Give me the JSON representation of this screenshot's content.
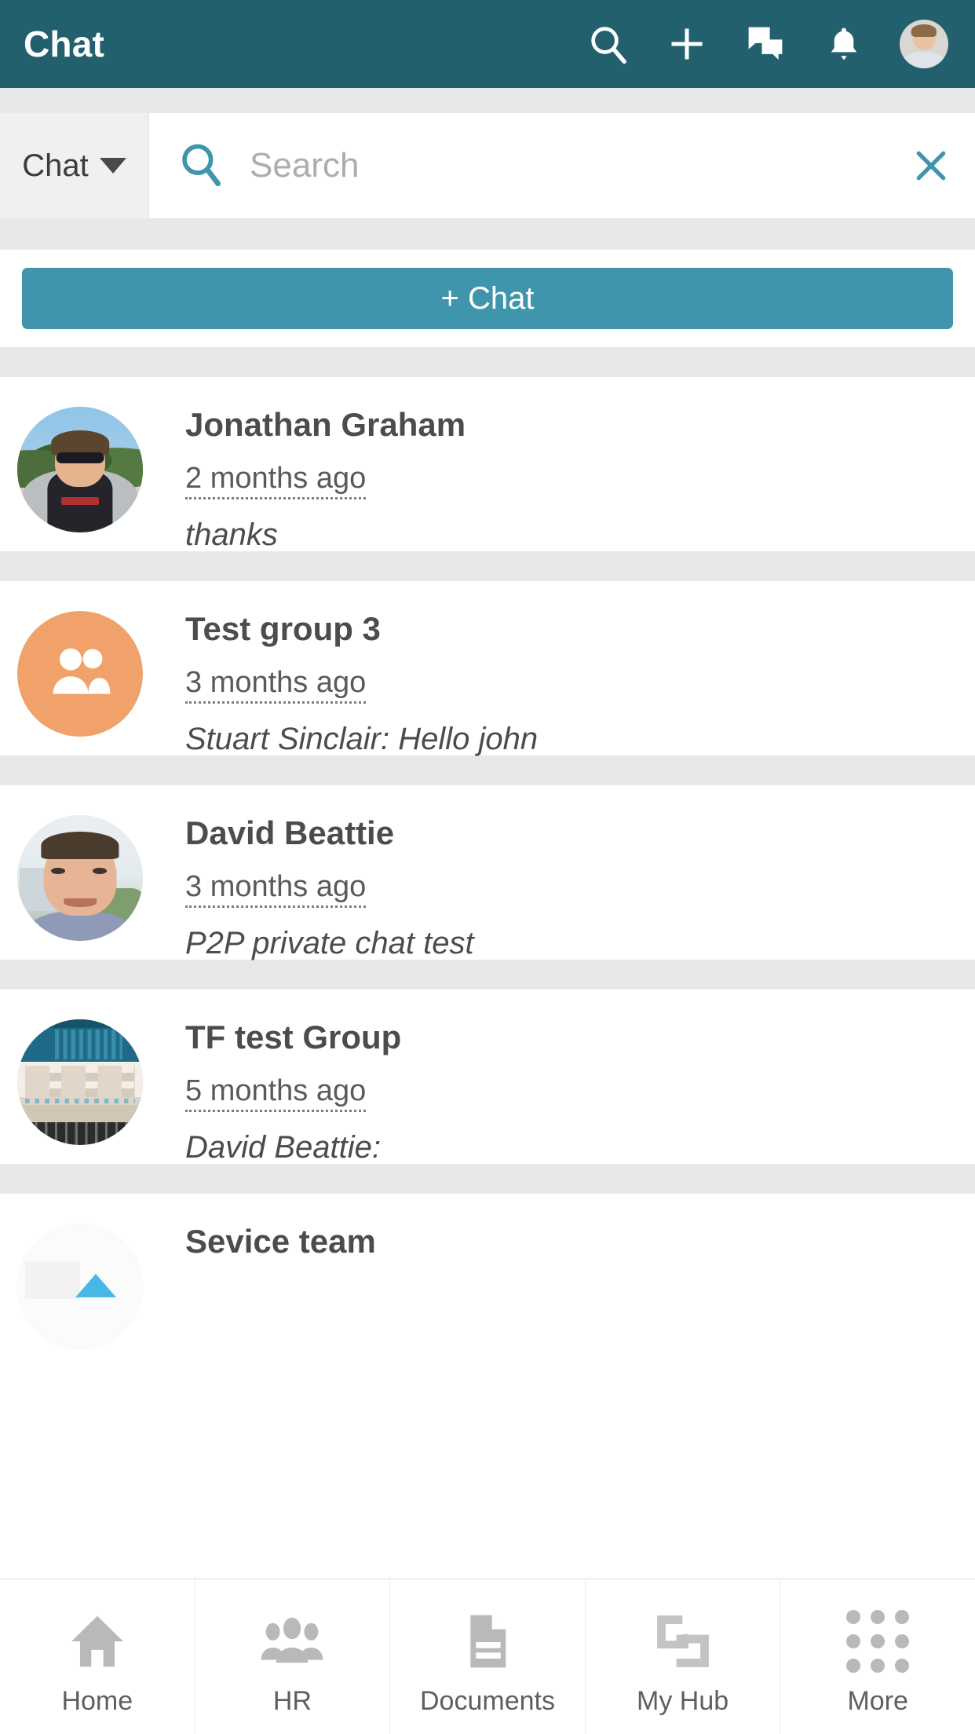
{
  "header": {
    "title": "Chat",
    "icons": [
      {
        "name": "search-icon",
        "label": "Search"
      },
      {
        "name": "plus-icon",
        "label": "Add"
      },
      {
        "name": "chat-bubbles-icon",
        "label": "Chats"
      },
      {
        "name": "bell-icon",
        "label": "Notifications"
      }
    ],
    "avatar_name": "user-avatar",
    "bg_color": "#23606e"
  },
  "search": {
    "scope_label": "Chat",
    "scope_caret": "chevron-down-icon",
    "placeholder": "Search",
    "value": "",
    "clear_label": "✕",
    "accent_color": "#3f96ac"
  },
  "new_chat": {
    "label": "+ Chat",
    "bg_color": "#3f96ac"
  },
  "chat_list": [
    {
      "name": "Jonathan Graham",
      "time": "2 months ago",
      "preview": "thanks",
      "avatar_type": "photo-person-sunglasses"
    },
    {
      "name": "Test group 3",
      "time": "3 months ago",
      "preview": "Stuart Sinclair: Hello john",
      "avatar_type": "group-people-icon",
      "avatar_color": "#f0a26a"
    },
    {
      "name": "David Beattie",
      "time": "3 months ago",
      "preview": "P2P private chat test",
      "avatar_type": "photo-person-outdoor"
    },
    {
      "name": "TF test Group",
      "time": "5 months ago",
      "preview": "David Beattie:",
      "avatar_type": "photo-laptop-screen"
    },
    {
      "name": "Sevice team",
      "time": "",
      "preview": "",
      "avatar_type": "photo-partial"
    }
  ],
  "bottom_nav": [
    {
      "label": "Home",
      "icon": "home-icon"
    },
    {
      "label": "HR",
      "icon": "people-icon"
    },
    {
      "label": "Documents",
      "icon": "document-icon"
    },
    {
      "label": "My Hub",
      "icon": "linked-squares-icon"
    },
    {
      "label": "More",
      "icon": "grid-dots-icon"
    }
  ]
}
